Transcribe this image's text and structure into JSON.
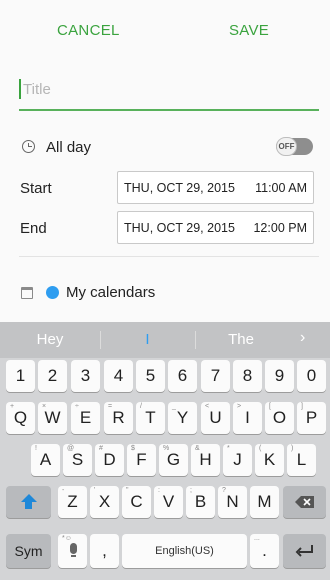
{
  "topbar": {
    "cancel": "CANCEL",
    "save": "SAVE",
    "accent": "#3aa33e"
  },
  "title": {
    "placeholder": "Title",
    "value": ""
  },
  "allday": {
    "label": "All day",
    "toggle_text": "OFF",
    "on": false
  },
  "start": {
    "label": "Start",
    "date": "THU, OCT 29, 2015",
    "time": "11:00 AM"
  },
  "end": {
    "label": "End",
    "date": "THU, OCT 29, 2015",
    "time": "12:00 PM"
  },
  "calendar": {
    "label": "My calendars",
    "dot_color": "#2e9df0"
  },
  "keyboard": {
    "suggestions": [
      "Hey",
      "I",
      "The"
    ],
    "suggest_more": "›",
    "numbers": [
      "1",
      "2",
      "3",
      "4",
      "5",
      "6",
      "7",
      "8",
      "9",
      "0"
    ],
    "row1": [
      "Q",
      "W",
      "E",
      "R",
      "T",
      "Y",
      "U",
      "I",
      "O",
      "P"
    ],
    "row1_hints": [
      "+",
      "×",
      "÷",
      "=",
      "/",
      "_",
      "<",
      ">",
      "[",
      "]"
    ],
    "row2": [
      "A",
      "S",
      "D",
      "F",
      "G",
      "H",
      "J",
      "K",
      "L"
    ],
    "row2_hints": [
      "!",
      "@",
      "#",
      "$",
      "%",
      "&",
      "*",
      "(",
      ")"
    ],
    "row3": [
      "Z",
      "X",
      "C",
      "V",
      "B",
      "N",
      "M"
    ],
    "row3_hints": [
      "-",
      "'",
      "\"",
      ":",
      ";",
      "?",
      ""
    ],
    "sym": "Sym",
    "comma": ",",
    "space": "English(US)",
    "period": ".",
    "mic_hint": "*☺",
    "period_hint": "..."
  }
}
